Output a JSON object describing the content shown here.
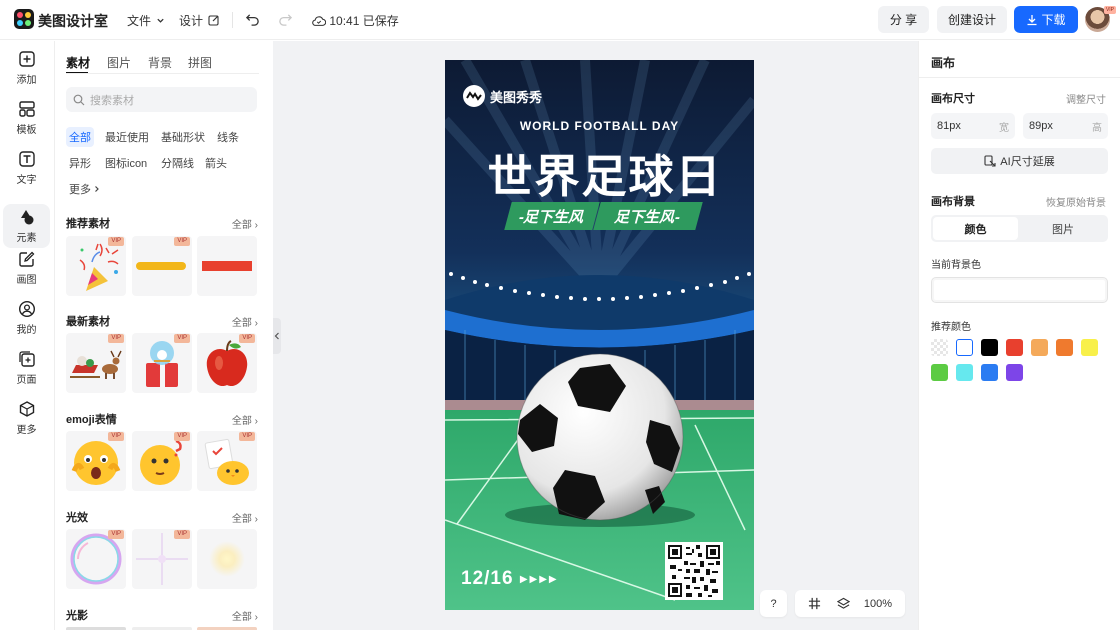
{
  "app": {
    "title": "美图设计室"
  },
  "topbar": {
    "menu_file": "文件",
    "menu_design": "设计",
    "save_status": "10:41 已保存",
    "share_label": "分 享",
    "create_label": "创建设计",
    "download_label": "下载",
    "avatar_badge": "VIP"
  },
  "left_rail": {
    "items": [
      {
        "label": "添加",
        "icon": "plus-square-icon"
      },
      {
        "label": "模板",
        "icon": "template-icon"
      },
      {
        "label": "文字",
        "icon": "text-icon"
      },
      {
        "label": "元素",
        "icon": "shapes-icon"
      },
      {
        "label": "画图",
        "icon": "pen-icon"
      },
      {
        "label": "我的",
        "icon": "user-icon"
      },
      {
        "label": "页面",
        "icon": "page-add-icon"
      },
      {
        "label": "更多",
        "icon": "cube-icon"
      }
    ],
    "active_index": 3
  },
  "panel": {
    "tabs": [
      "素材",
      "图片",
      "背景",
      "拼图"
    ],
    "active_tab": 0,
    "search_placeholder": "搜索素材",
    "chips": [
      "全部",
      "最近使用",
      "基础形状",
      "线条",
      "异形",
      "图标icon",
      "分隔线",
      "箭头",
      "更多"
    ],
    "active_chip": 0,
    "all_label": "全部",
    "vip_badge": "VIP",
    "sections": [
      {
        "title": "推荐素材"
      },
      {
        "title": "最新素材"
      },
      {
        "title": "emoji表情"
      },
      {
        "title": "光效"
      },
      {
        "title": "光影"
      }
    ]
  },
  "poster": {
    "brand": "美图秀秀",
    "subtitle": "WORLD FOOTBALL DAY",
    "title": "世界足球日",
    "slogan_left": "-足下生风",
    "slogan_right": "足下生风-",
    "date": "12/16"
  },
  "canvas_tools": {
    "help": "?",
    "zoom": "100%"
  },
  "right_panel": {
    "title": "画布",
    "size_label": "画布尺寸",
    "size_action": "调整尺寸",
    "width_value": "81px",
    "width_unit": "宽",
    "height_value": "89px",
    "height_unit": "高",
    "ai_button": "AI尺寸延展",
    "bg_label": "画布背景",
    "bg_reset": "恢复原始背景",
    "bg_tab_color": "颜色",
    "bg_tab_image": "图片",
    "current_color_label": "当前背景色",
    "recommended_label": "推荐颜色",
    "colors": [
      "transparent",
      "#ffffff",
      "#000000",
      "#e8402e",
      "#f4a95a",
      "#ef7a2e",
      "#f8f04a",
      "#5ccb43",
      "#66e8ee",
      "#2b7cf2",
      "#7d45e8"
    ]
  },
  "accent_color": "#1769ff"
}
